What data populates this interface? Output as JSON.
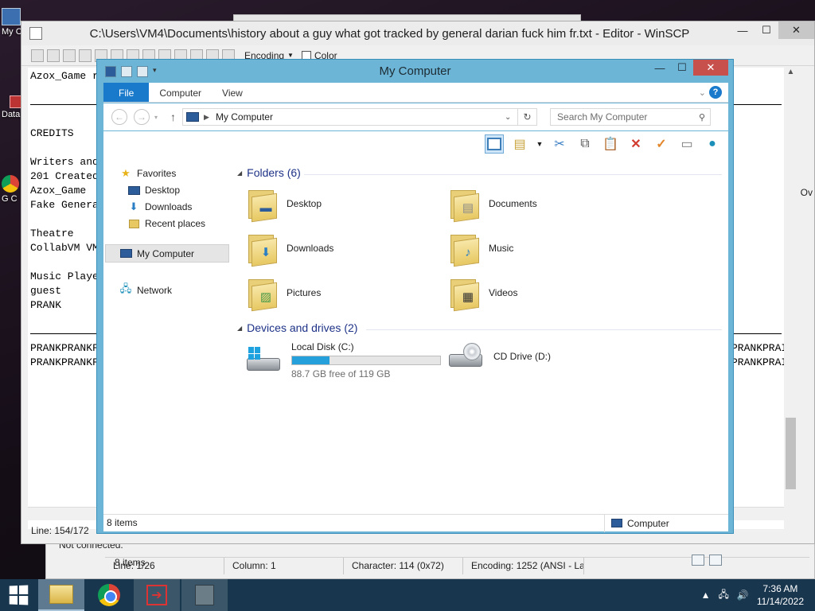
{
  "desktop": {
    "icons": [
      {
        "label": "My C"
      },
      {
        "label": "Data"
      },
      {
        "label": "G C"
      }
    ]
  },
  "winscp_main": {
    "status": "Not connected."
  },
  "winscp_statusbar": [
    "Line: 1/26",
    "Column: 1",
    "Character: 114 (0x72)",
    "Encoding: 1252  (ANSI - La"
  ],
  "editor": {
    "title": "C:\\Users\\VM4\\Documents\\history about a guy what got tracked by general darian fuck him fr.txt - Editor - WinSCP",
    "toolbar": {
      "encoding": "Encoding",
      "color": "Color"
    },
    "lines": [
      "Azox_Game r",
      "",
      "rule",
      "",
      "CREDITS",
      "",
      "Writers and",
      "201 Created",
      "Azox_Game",
      "Fake Genera",
      "",
      "Theatre",
      "CollabVM VM",
      "",
      "Music Playe",
      "guest",
      "PRANK",
      "",
      "rule",
      "PRANKPRANKF",
      "PRANKPRANKF"
    ],
    "right_text": [
      "PRANKPRAI",
      "PRANKPRAI"
    ],
    "side_text": "Ov",
    "status": "Line: 154/172"
  },
  "explorer": {
    "title": "My Computer",
    "tabs": {
      "file": "File",
      "computer": "Computer",
      "view": "View"
    },
    "address": "My Computer",
    "search_placeholder": "Search My Computer",
    "nav": {
      "favorites": "Favorites",
      "desktop": "Desktop",
      "downloads": "Downloads",
      "recent": "Recent places",
      "computer": "My Computer",
      "network": "Network"
    },
    "folders_header": "Folders (6)",
    "folders": [
      {
        "name": "Desktop",
        "icon": "desktop-folder-icon"
      },
      {
        "name": "Documents",
        "icon": "documents-folder-icon"
      },
      {
        "name": "Downloads",
        "icon": "downloads-folder-icon"
      },
      {
        "name": "Music",
        "icon": "music-folder-icon"
      },
      {
        "name": "Pictures",
        "icon": "pictures-folder-icon"
      },
      {
        "name": "Videos",
        "icon": "videos-folder-icon"
      }
    ],
    "drives_header": "Devices and drives (2)",
    "drives": [
      {
        "name": "Local Disk (C:)",
        "free": "88.7 GB free of 119 GB",
        "used_fraction": 0.25
      },
      {
        "name": "CD Drive (D:)"
      }
    ],
    "item_count": "8 items",
    "status_count": "8 items",
    "status_location": "Computer"
  },
  "taskbar": {
    "time": "7:36 AM",
    "date": "11/14/2022"
  }
}
